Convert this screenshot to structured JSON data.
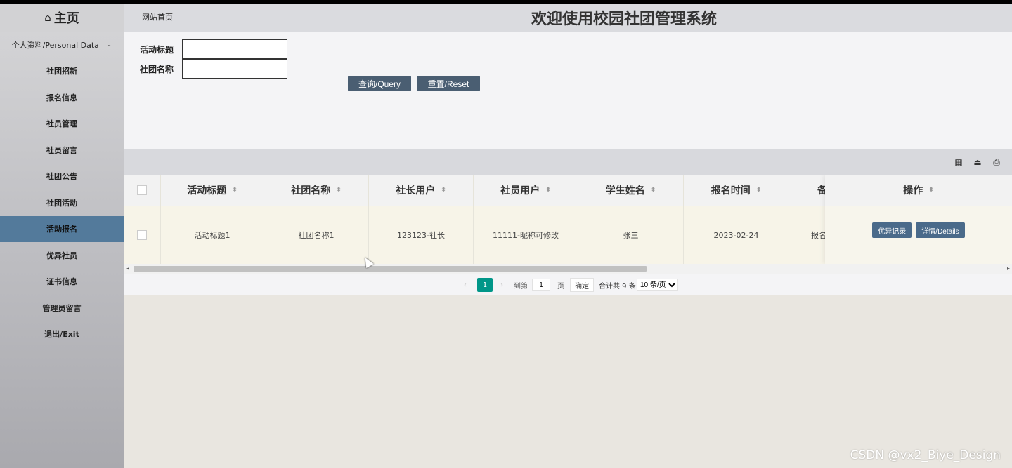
{
  "sidebar": {
    "home_label": "主页",
    "items": [
      {
        "label": "个人资料/Personal Data"
      },
      {
        "label": "社团招新"
      },
      {
        "label": "报名信息"
      },
      {
        "label": "社员管理"
      },
      {
        "label": "社员留言"
      },
      {
        "label": "社团公告"
      },
      {
        "label": "社团活动"
      },
      {
        "label": "活动报名"
      },
      {
        "label": "优异社员"
      },
      {
        "label": "证书信息"
      },
      {
        "label": "管理员留言"
      },
      {
        "label": "退出/Exit"
      }
    ],
    "active_index": 7
  },
  "header": {
    "breadcrumb": "网站首页",
    "title": "欢迎使用校园社团管理系统"
  },
  "search": {
    "field1_label": "活动标题",
    "field1_value": "",
    "field2_label": "社团名称",
    "field2_value": "",
    "query_label": "查询/Query",
    "reset_label": "重置/Reset"
  },
  "table": {
    "columns": [
      "活动标题",
      "社团名称",
      "社长用户",
      "社员用户",
      "学生姓名",
      "报名时间",
      "备"
    ],
    "ops_header": "操作",
    "rows": [
      {
        "cells": [
          "活动标题1",
          "社团名称1",
          "123123-社长",
          "11111-昵称可修改",
          "张三",
          "2023-02-24",
          "报名"
        ],
        "btn_excellent": "优异记录",
        "btn_details": "详情/Details"
      }
    ]
  },
  "pager": {
    "prev": "‹",
    "current": "1",
    "next": "›",
    "goto_label": "到第",
    "goto_value": "1",
    "page_unit": "页",
    "confirm": "确定",
    "total": "合计共 9 条",
    "page_size": "10 条/页"
  },
  "watermark": "CSDN @vx2_Biye_Design"
}
